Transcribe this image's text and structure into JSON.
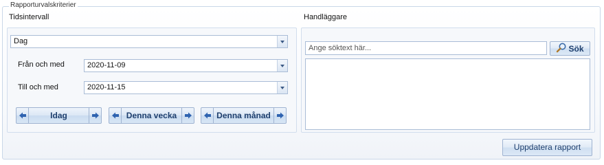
{
  "group_title": "Rapporturvalskriterier",
  "time_section": {
    "label": "Tidsintervall",
    "period_select": "Dag",
    "from_label": "Från och med",
    "from_value": "2020-11-09",
    "to_label": "Till och med",
    "to_value": "2020-11-15",
    "buttons": {
      "today": "Idag",
      "this_week": "Denna vecka",
      "this_month": "Denna månad"
    }
  },
  "handler_section": {
    "label": "Handläggare",
    "search_placeholder": "Ange söktext här...",
    "search_button": "Sök",
    "results": []
  },
  "update_button": "Uppdatera rapport",
  "icons": {
    "search": "magnifier-icon",
    "prev": "arrow-left-icon",
    "next": "arrow-right-icon",
    "dropdown": "chevron-down-icon"
  },
  "colors": {
    "accent": "#1e3f6e",
    "border": "#a9bcd6",
    "arrow": "#2f63b0"
  }
}
